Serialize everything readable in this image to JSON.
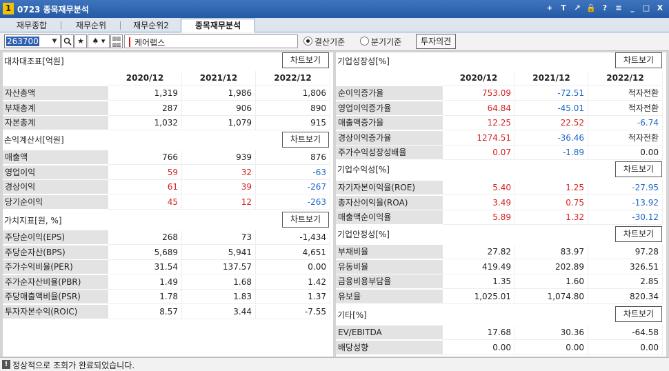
{
  "window": {
    "number": "1",
    "title": "0723 종목재무분석",
    "icons": [
      "plus-icon",
      "text-icon",
      "share-icon",
      "lock-icon",
      "help-icon",
      "menu-icon",
      "minimize-icon",
      "maximize-icon",
      "close-icon"
    ],
    "icon_glyphs": [
      "+",
      "T",
      "↗",
      "🔒",
      "?",
      "≡",
      "_",
      "□",
      "X"
    ]
  },
  "tabs": [
    {
      "label": "재무종합"
    },
    {
      "label": "재무순위"
    },
    {
      "label": "재무순위2"
    },
    {
      "label": "종목재무분석"
    }
  ],
  "toolbar": {
    "code": "263700",
    "name": "케어랩스",
    "radio1": "결산기준",
    "radio2": "분기기준",
    "invest_btn": "투자의견"
  },
  "chart_btn": "차트보기",
  "left": {
    "years": [
      "2020/12",
      "2021/12",
      "2022/12"
    ],
    "balance": {
      "title": "대차대조표[억원]",
      "rows": [
        {
          "label": "자산총액",
          "v": [
            "1,319",
            "1,986",
            "1,806"
          ]
        },
        {
          "label": "부채총계",
          "v": [
            "287",
            "906",
            "890"
          ]
        },
        {
          "label": "자본총계",
          "v": [
            "1,032",
            "1,079",
            "915"
          ]
        }
      ]
    },
    "income": {
      "title": "손익계산서[억원]",
      "rows": [
        {
          "label": "매출액",
          "v": [
            "766",
            "939",
            "876"
          ]
        },
        {
          "label": "영업이익",
          "v": [
            "59",
            "32",
            "-63"
          ]
        },
        {
          "label": "경상이익",
          "v": [
            "61",
            "39",
            "-267"
          ]
        },
        {
          "label": "당기순이익",
          "v": [
            "45",
            "12",
            "-263"
          ]
        }
      ]
    },
    "value": {
      "title": "가치지표[원, %]",
      "rows": [
        {
          "label": "주당순이익(EPS)",
          "v": [
            "268",
            "73",
            "-1,434"
          ]
        },
        {
          "label": "주당순자산(BPS)",
          "v": [
            "5,689",
            "5,941",
            "4,651"
          ]
        },
        {
          "label": "주가수익비율(PER)",
          "v": [
            "31.54",
            "137.57",
            "0.00"
          ]
        },
        {
          "label": "주가순자산비율(PBR)",
          "v": [
            "1.49",
            "1.68",
            "1.42"
          ]
        },
        {
          "label": "주당매출액비율(PSR)",
          "v": [
            "1.78",
            "1.83",
            "1.37"
          ]
        },
        {
          "label": "투자자본수익(ROIC)",
          "v": [
            "8.57",
            "3.44",
            "-7.55"
          ]
        }
      ]
    }
  },
  "right": {
    "growth": {
      "title": "기업성장성[%]",
      "rows": [
        {
          "label": "순이익증가율",
          "v": [
            "753.09",
            "-72.51",
            "적자전환"
          ]
        },
        {
          "label": "영업이익증가율",
          "v": [
            "64.84",
            "-45.01",
            "적자전환"
          ]
        },
        {
          "label": "매출액증가율",
          "v": [
            "12.25",
            "22.52",
            "-6.74"
          ]
        },
        {
          "label": "경상이익증가율",
          "v": [
            "1274.51",
            "-36.46",
            "적자전환"
          ]
        },
        {
          "label": "주가수익성장성배율",
          "v": [
            "0.07",
            "-1.89",
            "0.00"
          ]
        }
      ]
    },
    "profit": {
      "title": "기업수익성[%]",
      "rows": [
        {
          "label": "자기자본이익율(ROE)",
          "v": [
            "5.40",
            "1.25",
            "-27.95"
          ]
        },
        {
          "label": "총자산이익율(ROA)",
          "v": [
            "3.49",
            "0.75",
            "-13.92"
          ]
        },
        {
          "label": "매출액순이익율",
          "v": [
            "5.89",
            "1.32",
            "-30.12"
          ]
        }
      ]
    },
    "stability": {
      "title": "기업안정성[%]",
      "rows": [
        {
          "label": "부채비율",
          "v": [
            "27.82",
            "83.97",
            "97.28"
          ]
        },
        {
          "label": "유동비율",
          "v": [
            "419.49",
            "202.89",
            "326.51"
          ]
        },
        {
          "label": "금융비용부담율",
          "v": [
            "1.35",
            "1.60",
            "2.85"
          ]
        },
        {
          "label": "유보율",
          "v": [
            "1,025.01",
            "1,074.80",
            "820.34"
          ]
        }
      ]
    },
    "other": {
      "title": "기타[%]",
      "rows": [
        {
          "label": "EV/EBITDA",
          "v": [
            "17.68",
            "30.36",
            "-64.58"
          ]
        },
        {
          "label": "배당성향",
          "v": [
            "0.00",
            "0.00",
            "0.00"
          ]
        }
      ]
    }
  },
  "status": "정상적으로 조회가 완료되었습니다.",
  "colors": {
    "red": "#d42020",
    "blue": "#1c66c8"
  },
  "color_map": {
    "left.income.rows.1": [
      "red",
      "red",
      "blue"
    ],
    "left.income.rows.2": [
      "red",
      "red",
      "blue"
    ],
    "left.income.rows.3": [
      "red",
      "red",
      "blue"
    ],
    "right.growth.rows.0": [
      "red",
      "blue",
      ""
    ],
    "right.growth.rows.1": [
      "red",
      "blue",
      ""
    ],
    "right.growth.rows.2": [
      "red",
      "red",
      "blue"
    ],
    "right.growth.rows.3": [
      "red",
      "blue",
      ""
    ],
    "right.growth.rows.4": [
      "red",
      "blue",
      ""
    ],
    "right.profit.rows.0": [
      "red",
      "red",
      "blue"
    ],
    "right.profit.rows.1": [
      "red",
      "red",
      "blue"
    ],
    "right.profit.rows.2": [
      "red",
      "red",
      "blue"
    ]
  }
}
